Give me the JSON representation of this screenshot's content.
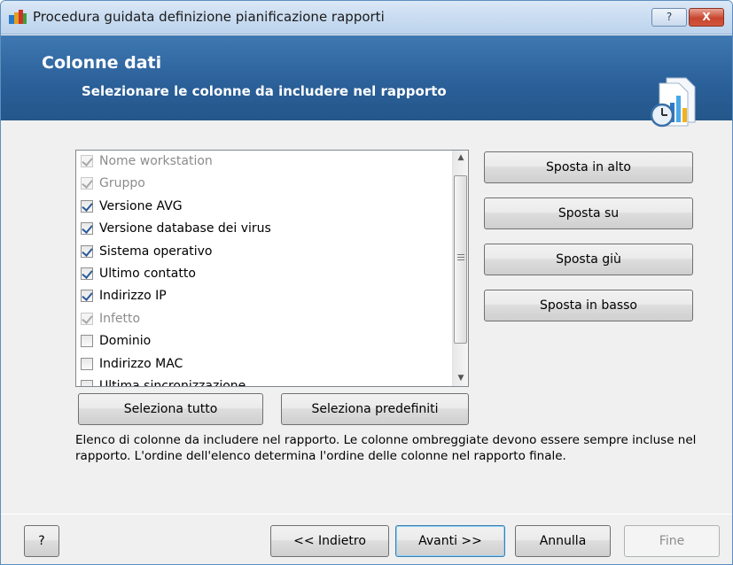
{
  "window": {
    "title": "Procedura guidata definizione pianificazione rapporti",
    "help_label": "?",
    "close_label": "X"
  },
  "banner": {
    "title": "Colonne dati",
    "subtitle": "Selezionare le colonne da includere nel rapporto",
    "icon": "report-schedule-icon"
  },
  "columns_list": {
    "items": [
      {
        "label": "Nome workstation",
        "checked": true,
        "disabled": true
      },
      {
        "label": "Gruppo",
        "checked": true,
        "disabled": true
      },
      {
        "label": "Versione AVG",
        "checked": true,
        "disabled": false
      },
      {
        "label": "Versione database dei virus",
        "checked": true,
        "disabled": false
      },
      {
        "label": "Sistema operativo",
        "checked": true,
        "disabled": false
      },
      {
        "label": "Ultimo contatto",
        "checked": true,
        "disabled": false
      },
      {
        "label": "Indirizzo IP",
        "checked": true,
        "disabled": false
      },
      {
        "label": "Infetto",
        "checked": true,
        "disabled": true
      },
      {
        "label": "Dominio",
        "checked": false,
        "disabled": false
      },
      {
        "label": "Indirizzo MAC",
        "checked": false,
        "disabled": false
      },
      {
        "label": "Ultima sincronizzazione",
        "checked": false,
        "disabled": false
      }
    ]
  },
  "buttons": {
    "move_top": "Sposta in alto",
    "move_up": "Sposta su",
    "move_down": "Sposta giù",
    "move_bottom": "Sposta in basso",
    "select_all": "Seleziona tutto",
    "select_defaults": "Seleziona predefiniti"
  },
  "description": "Elenco di colonne da includere nel rapporto. Le colonne ombreggiate devono essere sempre incluse nel rapporto. L'ordine dell'elenco determina l'ordine delle colonne nel rapporto finale.",
  "footer": {
    "help": "?",
    "back": "<< Indietro",
    "next": "Avanti >>",
    "cancel": "Annulla",
    "finish": "Fine"
  },
  "colors": {
    "banner": "#2a5f98",
    "checkmark": "#2d5a9a",
    "close_button": "#c8452e"
  }
}
